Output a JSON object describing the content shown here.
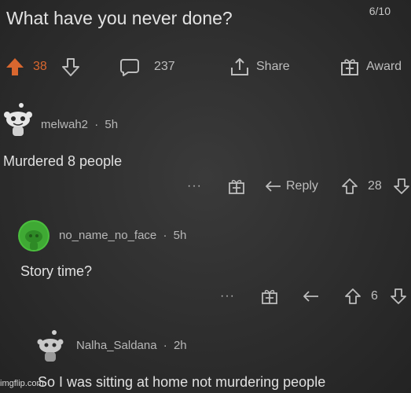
{
  "post": {
    "title": "What have you never done?",
    "page_counter": "6/10",
    "vote_count": "38",
    "comment_count": "237",
    "share_label": "Share",
    "award_label": "Award"
  },
  "comments": [
    {
      "username": "melwah2",
      "age": "5h",
      "text": "Murdered 8 people",
      "more": "···",
      "reply_label": "Reply",
      "votes": "28"
    },
    {
      "username": "no_name_no_face",
      "age": "5h",
      "text": "Story time?",
      "more": "···",
      "votes": "6"
    },
    {
      "username": "Nalha_Saldana",
      "age": "2h",
      "text": "So I was sitting at home not murdering people"
    }
  ],
  "separator": "·",
  "watermark": "imgflip.com",
  "colors": {
    "background": "#2c2c2c",
    "upvote_active": "#d9672f",
    "text": "#e0e0e0",
    "muted": "#b8b8b8",
    "avatar_green": "#4bbf3e"
  }
}
